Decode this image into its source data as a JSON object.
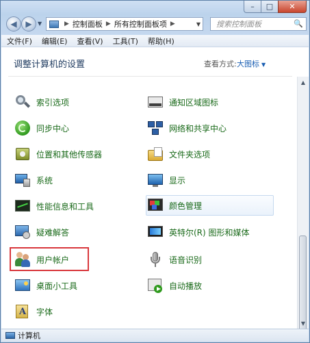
{
  "window": {
    "caption_buttons": {
      "minimize": "–",
      "maximize": "□",
      "close": "✕"
    }
  },
  "address": {
    "segments": [
      "控制面板",
      "所有控制面板项"
    ],
    "search_placeholder": "搜索控制面板"
  },
  "menu": [
    "文件(F)",
    "编辑(E)",
    "查看(V)",
    "工具(T)",
    "帮助(H)"
  ],
  "header": {
    "title": "调整计算机的设置",
    "view_label": "查看方式:",
    "view_value": "大图标"
  },
  "items_left": [
    "索引选项",
    "同步中心",
    "位置和其他传感器",
    "系统",
    "性能信息和工具",
    "疑难解答",
    "用户帐户",
    "桌面小工具",
    "字体"
  ],
  "items_right": [
    "通知区域图标",
    "网络和共享中心",
    "文件夹选项",
    "显示",
    "颜色管理",
    "英特尔(R) 图形和媒体",
    "语音识别",
    "自动播放"
  ],
  "statusbar": {
    "text": "计算机"
  },
  "icons": {
    "search": "magnifier-icon",
    "sync": "sync-icon",
    "location": "location-sensor-icon",
    "system": "system-icon",
    "performance": "performance-icon",
    "troubleshoot": "troubleshoot-icon",
    "users": "user-accounts-icon",
    "gadgets": "gadgets-icon",
    "fonts": "fonts-icon",
    "notification": "notification-area-icon",
    "network": "network-icon",
    "folder_options": "folder-options-icon",
    "display": "display-icon",
    "color": "color-management-icon",
    "intel": "intel-graphics-icon",
    "speech": "speech-recognition-icon",
    "autoplay": "autoplay-icon"
  },
  "colors": {
    "item_text": "#1a6a1a",
    "highlight_box": "#d9373c",
    "link_blue": "#1b5fb3"
  }
}
